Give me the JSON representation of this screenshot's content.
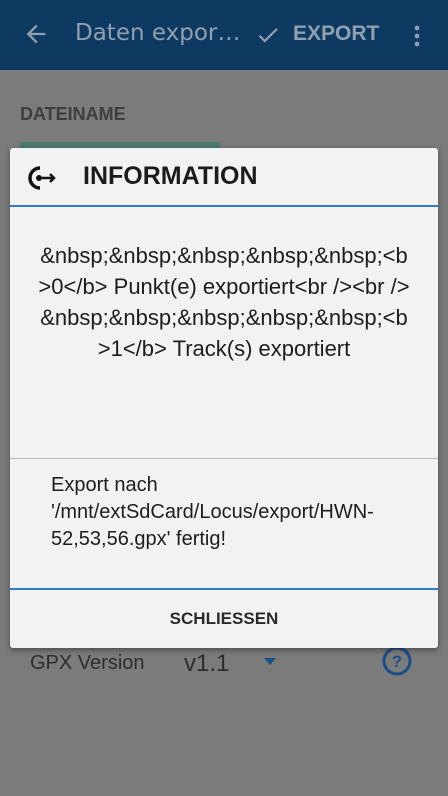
{
  "appbar": {
    "title": "Daten expor…",
    "export_label": "EXPORT"
  },
  "background": {
    "section_label": "DATEINAME",
    "gpx_label": "GPX Version",
    "gpx_value": "v1.1"
  },
  "dialog": {
    "title": "INFORMATION",
    "message": "&nbsp;&nbsp;&nbsp;&nbsp;&nbsp;<b>0</b> Punkt(e) exportiert<br /><br />&nbsp;&nbsp;&nbsp;&nbsp;&nbsp;<b>1</b> Track(s) exportiert",
    "detail": "Export nach '/mnt/extSdCard/Locus/export/HWN-52,53,56.gpx' fertig!",
    "close_label": "SCHLIESSEN"
  },
  "colors": {
    "appbar_bg": "#0e3a62",
    "accent_blue": "#2f7bc4",
    "dialog_bg": "#f2f2f2"
  },
  "icons": [
    "back-arrow-icon",
    "check-icon",
    "more-vert-icon",
    "locus-logo-icon",
    "dropdown-arrow-icon",
    "help-icon"
  ]
}
